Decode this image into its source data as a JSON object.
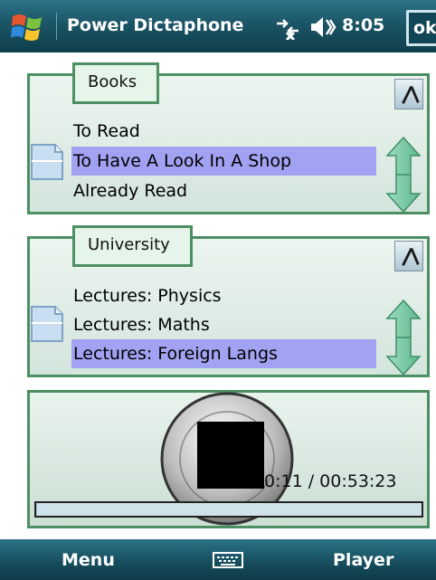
{
  "titlebar": {
    "app_title": "Power Dictaphone",
    "clock": "8:05",
    "ok_label": "ok",
    "icons": [
      "windows-start-icon",
      "connectivity-icon",
      "volume-icon"
    ]
  },
  "panels": [
    {
      "tab_label": "Books",
      "items": [
        {
          "label": "To Read",
          "selected": false
        },
        {
          "label": "To Have A Look In A Shop",
          "selected": true
        },
        {
          "label": "Already Read",
          "selected": false
        }
      ],
      "icons": [
        "document-icon",
        "edit-icon",
        "up-down-arrow-icon"
      ]
    },
    {
      "tab_label": "University",
      "items": [
        {
          "label": "Lectures: Physics",
          "selected": false
        },
        {
          "label": "Lectures: Maths",
          "selected": false
        },
        {
          "label": "Lectures: Foreign Langs",
          "selected": true
        }
      ],
      "icons": [
        "document-icon",
        "edit-icon",
        "up-down-arrow-icon"
      ]
    }
  ],
  "player": {
    "time": "0:11 / 00:53:23",
    "progress": 0.0034,
    "stop_icon": "stop-icon"
  },
  "softkeys": {
    "left": "Menu",
    "right": "Player",
    "center_icon": "keyboard-icon"
  },
  "colors": {
    "titlebar": "#1b5566",
    "panel_border": "#4c8f63",
    "selection": "#a2a2f2"
  }
}
